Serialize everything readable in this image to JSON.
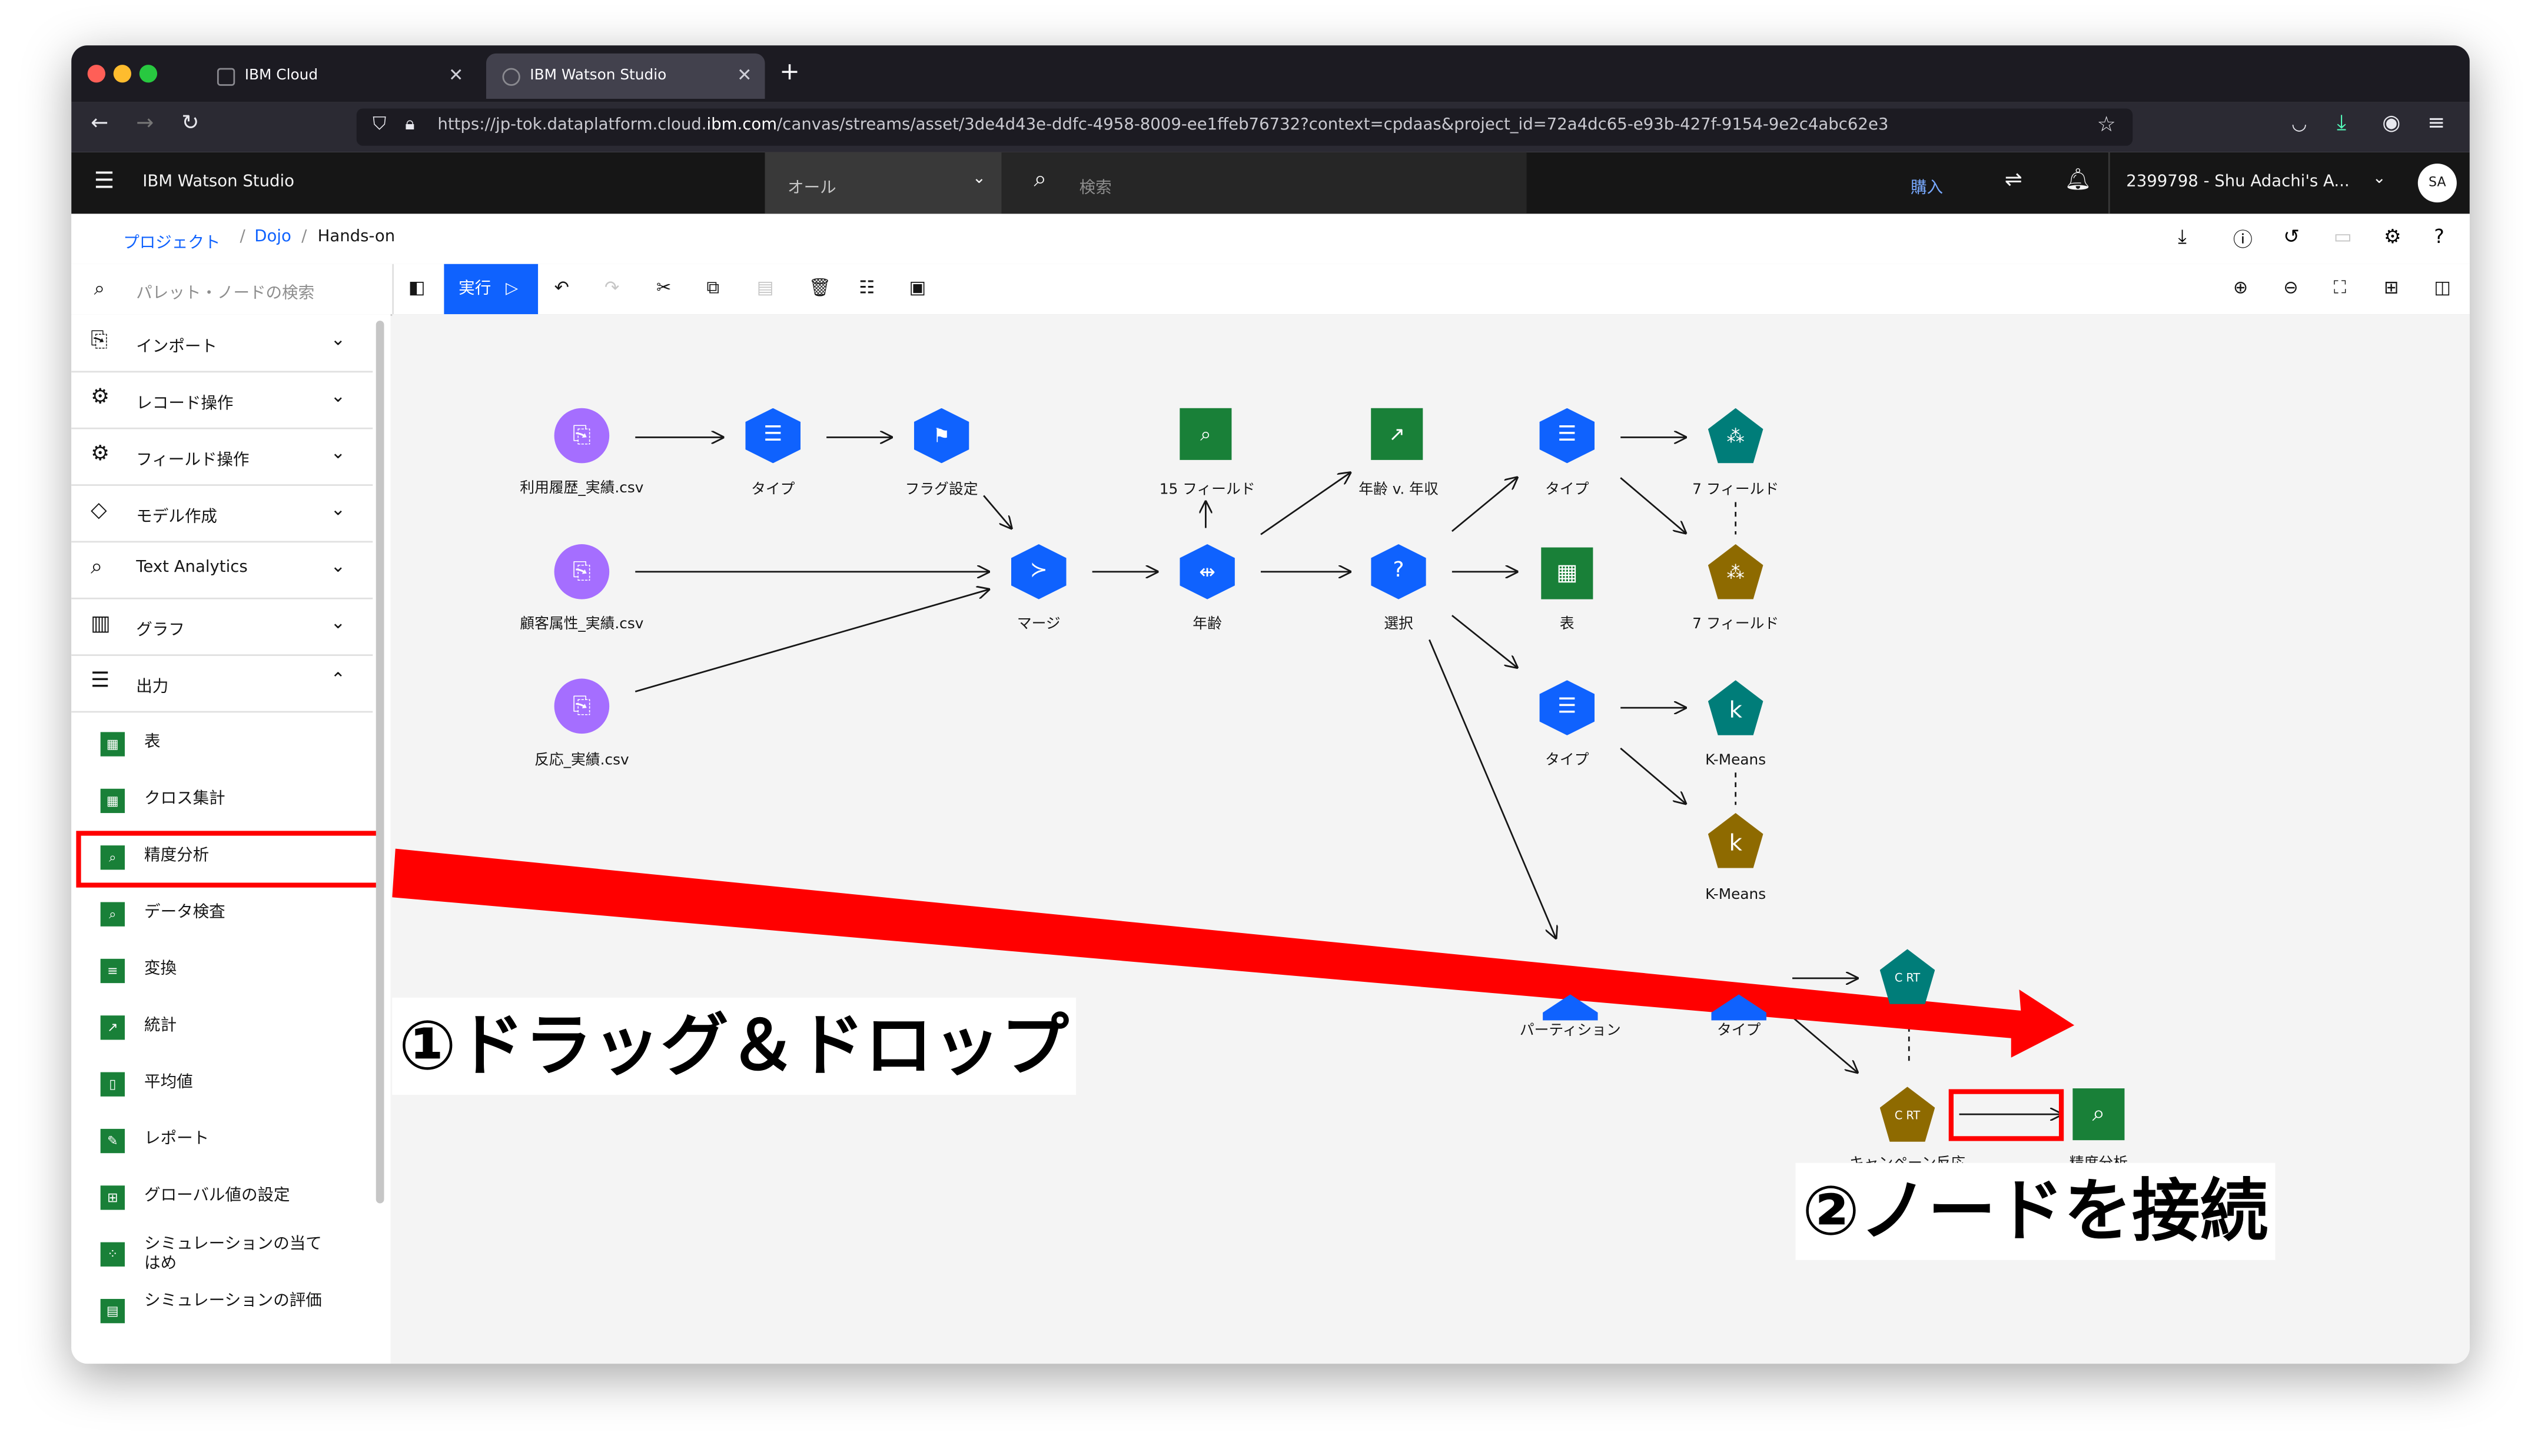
{
  "browser": {
    "tabs": [
      {
        "label": "IBM Cloud"
      },
      {
        "label": "IBM Watson Studio"
      }
    ],
    "url_prefix": "https://jp-tok.dataplatform.cloud.",
    "url_domain": "ibm.com",
    "url_rest": "/canvas/streams/asset/3de4d43e-ddfc-4958-8009-ee1ffeb76732?context=cpdaas&project_id=72a4dc65-e93b-427f-9154-9e2c4abc62e3"
  },
  "header": {
    "app_title": "IBM Watson Studio",
    "scope": "オール",
    "search_placeholder": "検索",
    "buy": "購入",
    "account": "2399798 - Shu Adachi's A...",
    "avatar": "SA"
  },
  "breadcrumb": [
    "プロジェクト",
    "Dojo",
    "Hands-on"
  ],
  "toolbar": {
    "palette_search_placeholder": "パレット・ノードの検索",
    "run_label": "実行"
  },
  "sidebar": {
    "categories": [
      {
        "label": "インポート"
      },
      {
        "label": "レコード操作"
      },
      {
        "label": "フィールド操作"
      },
      {
        "label": "モデル作成"
      },
      {
        "label": "Text Analytics"
      },
      {
        "label": "グラフ"
      },
      {
        "label": "出力"
      }
    ],
    "output_items": [
      {
        "label": "表"
      },
      {
        "label": "クロス集計"
      },
      {
        "label": "精度分析"
      },
      {
        "label": "データ検査"
      },
      {
        "label": "変換"
      },
      {
        "label": "統計"
      },
      {
        "label": "平均値"
      },
      {
        "label": "レポート"
      },
      {
        "label": "グローバル値の設定"
      },
      {
        "label": "シミュレーションの当てはめ"
      },
      {
        "label": "シミュレーションの評価"
      }
    ]
  },
  "nodes": {
    "n1": "利用履歴_実績.csv",
    "n2": "顧客属性_実績.csv",
    "n3": "反応_実績.csv",
    "type1": "タイプ",
    "flag": "フラグ設定",
    "merge": "マージ",
    "fields15": "15 フィールド",
    "age": "年齢",
    "agevs": "年齢 v. 年収",
    "select": "選択",
    "type2": "タイプ",
    "table": "表",
    "type3": "タイプ",
    "fields7a": "7 フィールド",
    "fields7b": "7 フィールド",
    "kmeans1": "K-Means",
    "kmeans2": "K-Means",
    "partition": "パーティション",
    "type4": "タイプ",
    "campaign": "キャンペーン反応",
    "analysis": "精度分析"
  },
  "annotations": {
    "step1": "①ドラッグ＆ドロップ",
    "step2": "②ノードを接続",
    "highlight_color": "#ff0000"
  },
  "colors": {
    "import_purple": "#a56eff",
    "field_blue": "#0f62fe",
    "output_green": "#198038",
    "model_teal": "#007d79",
    "nugget_gold": "#8e6a00"
  }
}
